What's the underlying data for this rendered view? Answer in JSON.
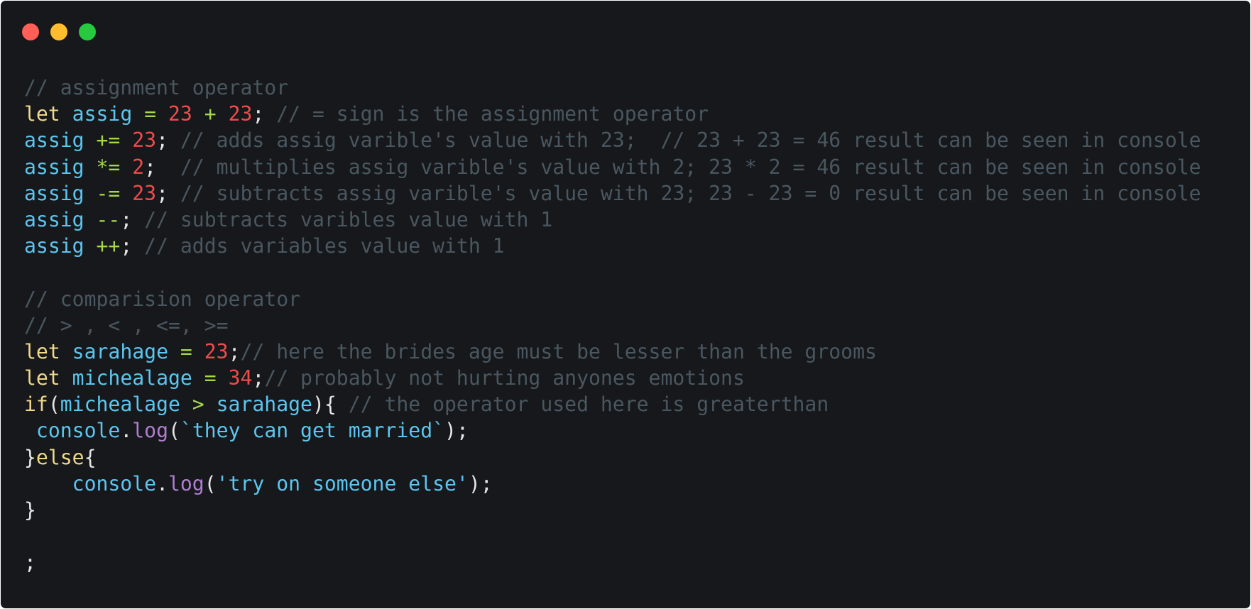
{
  "window": {
    "controls": [
      {
        "name": "close",
        "color": "#ff5f56"
      },
      {
        "name": "minimize",
        "color": "#ffbd2e"
      },
      {
        "name": "maximize",
        "color": "#27c93f"
      }
    ]
  },
  "code": {
    "lines": [
      [
        {
          "t": "// assignment operator",
          "k": "cm"
        }
      ],
      [
        {
          "t": "let",
          "k": "kw"
        },
        {
          "t": " ",
          "k": "pn"
        },
        {
          "t": "assig",
          "k": "var"
        },
        {
          "t": " = ",
          "k": "op"
        },
        {
          "t": "23",
          "k": "num"
        },
        {
          "t": " + ",
          "k": "op"
        },
        {
          "t": "23",
          "k": "num"
        },
        {
          "t": "; ",
          "k": "pn"
        },
        {
          "t": "// = sign is the assignment operator",
          "k": "cm"
        }
      ],
      [
        {
          "t": "assig",
          "k": "var"
        },
        {
          "t": " += ",
          "k": "op"
        },
        {
          "t": "23",
          "k": "num"
        },
        {
          "t": "; ",
          "k": "pn"
        },
        {
          "t": "// adds assig varible's value with 23;  // 23 + 23 = 46 result can be seen in console",
          "k": "cm"
        }
      ],
      [
        {
          "t": "assig",
          "k": "var"
        },
        {
          "t": " *= ",
          "k": "op"
        },
        {
          "t": "2",
          "k": "num"
        },
        {
          "t": ";  ",
          "k": "pn"
        },
        {
          "t": "// multiplies assig varible's value with 2; 23 * 2 = 46 result can be seen in console",
          "k": "cm"
        }
      ],
      [
        {
          "t": "assig",
          "k": "var"
        },
        {
          "t": " -= ",
          "k": "op"
        },
        {
          "t": "23",
          "k": "num"
        },
        {
          "t": "; ",
          "k": "pn"
        },
        {
          "t": "// subtracts assig varible's value with 23; 23 - 23 = 0 result can be seen in console",
          "k": "cm"
        }
      ],
      [
        {
          "t": "assig",
          "k": "var"
        },
        {
          "t": " --",
          "k": "op"
        },
        {
          "t": "; ",
          "k": "pn"
        },
        {
          "t": "// subtracts varibles value with 1",
          "k": "cm"
        }
      ],
      [
        {
          "t": "assig",
          "k": "var"
        },
        {
          "t": " ++",
          "k": "op"
        },
        {
          "t": "; ",
          "k": "pn"
        },
        {
          "t": "// adds variables value with 1",
          "k": "cm"
        }
      ],
      [],
      [
        {
          "t": "// comparision operator",
          "k": "cm"
        }
      ],
      [
        {
          "t": "// > , < , <=, >=",
          "k": "cm"
        }
      ],
      [
        {
          "t": "let",
          "k": "kw"
        },
        {
          "t": " ",
          "k": "pn"
        },
        {
          "t": "sarahage",
          "k": "var"
        },
        {
          "t": " = ",
          "k": "op"
        },
        {
          "t": "23",
          "k": "num"
        },
        {
          "t": ";",
          "k": "pn"
        },
        {
          "t": "// here the brides age must be lesser than the grooms",
          "k": "cm"
        }
      ],
      [
        {
          "t": "let",
          "k": "kw"
        },
        {
          "t": " ",
          "k": "pn"
        },
        {
          "t": "michealage",
          "k": "var"
        },
        {
          "t": " = ",
          "k": "op"
        },
        {
          "t": "34",
          "k": "num"
        },
        {
          "t": ";",
          "k": "pn"
        },
        {
          "t": "// probably not hurting anyones emotions",
          "k": "cm"
        }
      ],
      [
        {
          "t": "if",
          "k": "kw"
        },
        {
          "t": "(",
          "k": "pn"
        },
        {
          "t": "michealage",
          "k": "var"
        },
        {
          "t": " > ",
          "k": "op"
        },
        {
          "t": "sarahage",
          "k": "var"
        },
        {
          "t": "){ ",
          "k": "pn"
        },
        {
          "t": "// the operator used here is greaterthan",
          "k": "cm"
        }
      ],
      [
        {
          "t": " ",
          "k": "pn"
        },
        {
          "t": "console",
          "k": "var"
        },
        {
          "t": ".",
          "k": "pn"
        },
        {
          "t": "log",
          "k": "fn"
        },
        {
          "t": "(",
          "k": "pn"
        },
        {
          "t": "`they can get married`",
          "k": "str"
        },
        {
          "t": ");",
          "k": "pn"
        }
      ],
      [
        {
          "t": "}",
          "k": "pn"
        },
        {
          "t": "else",
          "k": "kw"
        },
        {
          "t": "{",
          "k": "pn"
        }
      ],
      [
        {
          "t": "    ",
          "k": "pn"
        },
        {
          "t": "console",
          "k": "var"
        },
        {
          "t": ".",
          "k": "pn"
        },
        {
          "t": "log",
          "k": "fn"
        },
        {
          "t": "(",
          "k": "pn"
        },
        {
          "t": "'try on someone else'",
          "k": "str"
        },
        {
          "t": ");",
          "k": "pn"
        }
      ],
      [
        {
          "t": "}",
          "k": "pn"
        }
      ],
      [],
      [
        {
          "t": ";",
          "k": "pn"
        }
      ]
    ]
  }
}
